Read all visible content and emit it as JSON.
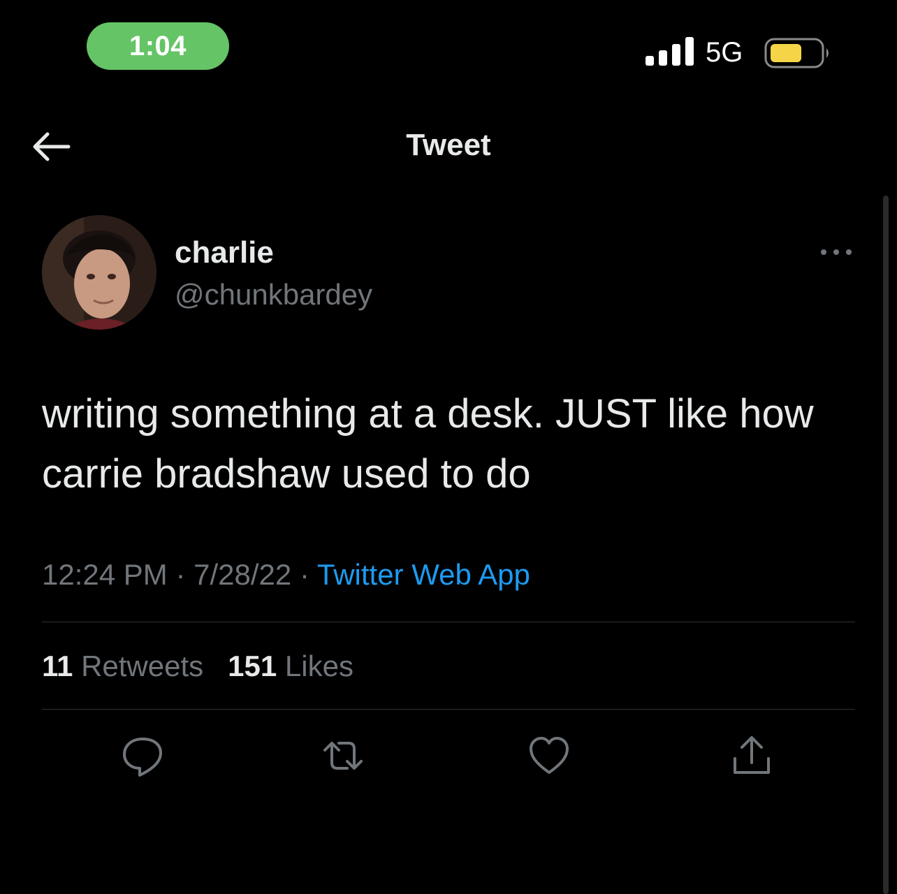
{
  "status_bar": {
    "time": "1:04",
    "network": "5G",
    "pill_color": "#65c466",
    "battery_color": "#f5d547"
  },
  "nav": {
    "title": "Tweet",
    "back_icon": "arrow-left-icon"
  },
  "tweet": {
    "author": {
      "display_name": "charlie",
      "handle": "@chunkbardey"
    },
    "text": "writing something at a desk. JUST like how carrie bradshaw used to do",
    "time": "12:24 PM",
    "date": "7/28/22",
    "source": "Twitter Web App",
    "separator": "·",
    "stats": {
      "retweets_count": "11",
      "retweets_label": "Retweets",
      "likes_count": "151",
      "likes_label": "Likes"
    }
  },
  "actions": [
    {
      "name": "reply",
      "icon": "speech-bubble-icon"
    },
    {
      "name": "retweet",
      "icon": "retweet-icon"
    },
    {
      "name": "like",
      "icon": "heart-icon"
    },
    {
      "name": "share",
      "icon": "share-icon"
    }
  ],
  "colors": {
    "background": "#000000",
    "text_primary": "#e7e9ea",
    "text_secondary": "#71767b",
    "link": "#1d9bf0",
    "divider": "#2f3336"
  }
}
